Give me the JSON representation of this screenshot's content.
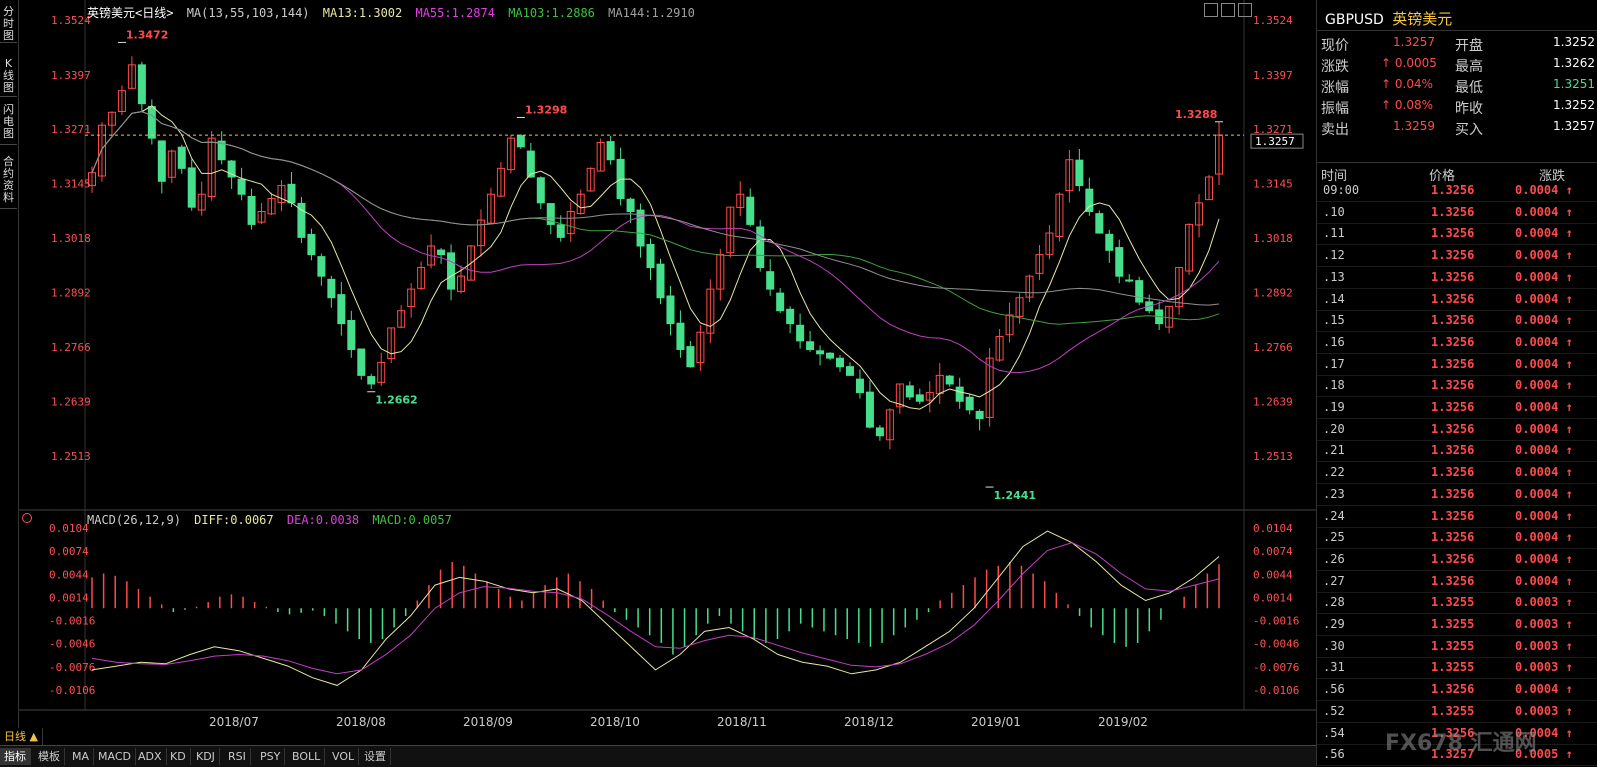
{
  "left_tabs": [
    "分时图",
    "K线图",
    "闪电图",
    "合约资料"
  ],
  "legend": {
    "symbol": "英镑美元",
    "period": "<日线>",
    "ma_params": "MA(13,55,103,144)",
    "ma13": "MA13:1.3002",
    "ma55": "MA55:1.2874",
    "ma103": "MA103:1.2886",
    "ma144": "MA144:1.2910"
  },
  "macd_legend": {
    "params": "MACD(26,12,9)",
    "diff": "DIFF:0.0067",
    "dea": "DEA:0.0038",
    "macd": "MACD:0.0057"
  },
  "colors": {
    "up": "#ff4a4a",
    "down": "#46e08c",
    "ma13": "#e8e8a0",
    "ma55": "#c040c0",
    "ma103": "#40a040",
    "ma144": "#909090",
    "price_axis": "#ff5050",
    "ma55_text": "#e040e0",
    "ma103_text": "#40c040",
    "ma144_text": "#a0a0a0"
  },
  "price_axis": [
    "1.3524",
    "1.3397",
    "1.3271",
    "1.3145",
    "1.3018",
    "1.2892",
    "1.2766",
    "1.2639",
    "1.2513"
  ],
  "macd_axis": [
    "0.0104",
    "0.0074",
    "0.0044",
    "0.0014",
    "-0.0016",
    "-0.0046",
    "-0.0076",
    "-0.0106"
  ],
  "annotations": {
    "high1": "1.3472",
    "high2": "1.3298",
    "high3": "1.3288",
    "low1": "1.2662",
    "low2": "1.2441",
    "current": "1.3257"
  },
  "date_axis": [
    "2018/07",
    "2018/08",
    "2018/09",
    "2018/10",
    "2018/11",
    "2018/12",
    "2019/01",
    "2019/02"
  ],
  "quote": {
    "code": "GBPUSD",
    "name": "英镑美元",
    "rows": [
      {
        "l1": "现价",
        "v1": "1.3257",
        "l2": "开盘",
        "v2": "1.3252"
      },
      {
        "l1": "涨跌",
        "v1": "0.0005",
        "l2": "最高",
        "v2": "1.3262"
      },
      {
        "l1": "涨幅",
        "v1": "0.04%",
        "l2": "最低",
        "v2": "1.3251"
      },
      {
        "l1": "振幅",
        "v1": "0.08%",
        "l2": "昨收",
        "v2": "1.3252"
      },
      {
        "l1": "卖出",
        "v1": "1.3259",
        "l2": "买入",
        "v2": "1.3257"
      }
    ],
    "ticks_header": {
      "time": "时间",
      "price": "价格",
      "change": "涨跌"
    },
    "ticks": [
      {
        "t": "09:00",
        "p": "1.3256",
        "c": "0.0004"
      },
      {
        "t": ".10",
        "p": "1.3256",
        "c": "0.0004"
      },
      {
        "t": ".11",
        "p": "1.3256",
        "c": "0.0004"
      },
      {
        "t": ".12",
        "p": "1.3256",
        "c": "0.0004"
      },
      {
        "t": ".13",
        "p": "1.3256",
        "c": "0.0004"
      },
      {
        "t": ".14",
        "p": "1.3256",
        "c": "0.0004"
      },
      {
        "t": ".15",
        "p": "1.3256",
        "c": "0.0004"
      },
      {
        "t": ".16",
        "p": "1.3256",
        "c": "0.0004"
      },
      {
        "t": ".17",
        "p": "1.3256",
        "c": "0.0004"
      },
      {
        "t": ".18",
        "p": "1.3256",
        "c": "0.0004"
      },
      {
        "t": ".19",
        "p": "1.3256",
        "c": "0.0004"
      },
      {
        "t": ".20",
        "p": "1.3256",
        "c": "0.0004"
      },
      {
        "t": ".21",
        "p": "1.3256",
        "c": "0.0004"
      },
      {
        "t": ".22",
        "p": "1.3256",
        "c": "0.0004"
      },
      {
        "t": ".23",
        "p": "1.3256",
        "c": "0.0004"
      },
      {
        "t": ".24",
        "p": "1.3256",
        "c": "0.0004"
      },
      {
        "t": ".25",
        "p": "1.3256",
        "c": "0.0004"
      },
      {
        "t": ".26",
        "p": "1.3256",
        "c": "0.0004"
      },
      {
        "t": ".27",
        "p": "1.3256",
        "c": "0.0004"
      },
      {
        "t": ".28",
        "p": "1.3255",
        "c": "0.0003"
      },
      {
        "t": ".29",
        "p": "1.3255",
        "c": "0.0003"
      },
      {
        "t": ".30",
        "p": "1.3255",
        "c": "0.0003"
      },
      {
        "t": ".31",
        "p": "1.3255",
        "c": "0.0003"
      },
      {
        "t": ".56",
        "p": "1.3256",
        "c": "0.0004"
      },
      {
        "t": ".52",
        "p": "1.3255",
        "c": "0.0003"
      },
      {
        "t": ".54",
        "p": "1.3256",
        "c": "0.0004"
      },
      {
        "t": ".56",
        "p": "1.3257",
        "c": "0.0005"
      }
    ]
  },
  "bottom_tabs": [
    "日线 ▲",
    "指标",
    "模板",
    "MA",
    "MACD",
    "ADX",
    "KD",
    "KDJ",
    "RSI",
    "PSY",
    "BOLL",
    "VOL",
    "设置"
  ],
  "watermark": "FX678 汇通网",
  "chart_data": [
    {
      "type": "candlestick",
      "title": "英镑美元<日线>",
      "ylim": [
        1.2441,
        1.3524
      ],
      "x_labels": [
        "2018/07",
        "2018/08",
        "2018/09",
        "2018/10",
        "2018/11",
        "2018/12",
        "2019/01",
        "2019/02"
      ],
      "close_series": [
        1.317,
        1.328,
        1.331,
        1.336,
        1.342,
        1.333,
        1.325,
        1.315,
        1.322,
        1.318,
        1.309,
        1.312,
        1.325,
        1.32,
        1.316,
        1.312,
        1.305,
        1.308,
        1.311,
        1.314,
        1.31,
        1.302,
        1.298,
        1.293,
        1.288,
        1.282,
        1.276,
        1.27,
        1.268,
        1.273,
        1.281,
        1.285,
        1.29,
        1.295,
        1.3,
        1.298,
        1.29,
        1.293,
        1.3,
        1.306,
        1.312,
        1.318,
        1.325,
        1.323,
        1.316,
        1.31,
        1.305,
        1.302,
        1.308,
        1.312,
        1.318,
        1.324,
        1.32,
        1.311,
        1.308,
        1.3,
        1.295,
        1.288,
        1.282,
        1.276,
        1.272,
        1.28,
        1.29,
        1.298,
        1.309,
        1.312,
        1.305,
        1.295,
        1.29,
        1.285,
        1.282,
        1.278,
        1.276,
        1.275,
        1.274,
        1.272,
        1.27,
        1.266,
        1.258,
        1.256,
        1.262,
        1.268,
        1.265,
        1.264,
        1.266,
        1.27,
        1.268,
        1.264,
        1.262,
        1.26,
        1.274,
        1.279,
        1.284,
        1.288,
        1.293,
        1.298,
        1.303,
        1.312,
        1.32,
        1.314,
        1.308,
        1.303,
        1.299,
        1.293,
        1.292,
        1.287,
        1.285,
        1.282,
        1.286,
        1.295,
        1.305,
        1.31,
        1.316,
        1.3257
      ],
      "highs": [
        {
          "label": "1.3472",
          "value": 1.3472
        },
        {
          "label": "1.3298",
          "value": 1.3298
        },
        {
          "label": "1.3288",
          "value": 1.3288
        }
      ],
      "lows": [
        {
          "label": "1.2662",
          "value": 1.2662
        },
        {
          "label": "1.2441",
          "value": 1.2441
        }
      ],
      "current": 1.3257
    },
    {
      "type": "bar",
      "title": "MACD(26,12,9)",
      "ylim": [
        -0.0106,
        0.0104
      ],
      "series": [
        {
          "name": "MACD",
          "values": [
            0.004,
            0.0045,
            0.0042,
            0.0035,
            0.0025,
            0.0015,
            0.0005,
            -0.0005,
            -0.0002,
            0.0002,
            0.0008,
            0.0015,
            0.0018,
            0.0015,
            0.0008,
            0.0002,
            -0.0005,
            -0.0008,
            -0.0006,
            -0.0003,
            -0.001,
            -0.002,
            -0.003,
            -0.004,
            -0.0045,
            -0.004,
            -0.0025,
            -0.001,
            0.001,
            0.003,
            0.005,
            0.006,
            0.0055,
            0.0045,
            0.0035,
            0.0025,
            0.0015,
            0.001,
            0.002,
            0.003,
            0.004,
            0.0045,
            0.0035,
            0.0025,
            0.001,
            -0.0005,
            -0.0015,
            -0.0025,
            -0.0035,
            -0.0045,
            -0.006,
            -0.005,
            -0.0035,
            -0.002,
            -0.001,
            -0.002,
            -0.003,
            -0.004,
            -0.0045,
            -0.004,
            -0.003,
            -0.002,
            -0.0025,
            -0.003,
            -0.0035,
            -0.004,
            -0.0045,
            -0.005,
            -0.0045,
            -0.0035,
            -0.0025,
            -0.0015,
            -0.0005,
            0.001,
            0.002,
            0.003,
            0.004,
            0.005,
            0.0055,
            0.006,
            0.0055,
            0.0045,
            0.0035,
            0.002,
            0.0005,
            -0.001,
            -0.0025,
            -0.0035,
            -0.0045,
            -0.005,
            -0.0045,
            -0.003,
            -0.0015,
            0.0,
            0.0015,
            0.003,
            0.0045,
            0.0057
          ]
        },
        {
          "name": "DIFF",
          "values": [
            -0.008,
            -0.0075,
            -0.007,
            -0.0072,
            -0.006,
            -0.005,
            -0.0055,
            -0.0065,
            -0.0075,
            -0.009,
            -0.01,
            -0.008,
            -0.004,
            -0.001,
            0.003,
            0.004,
            0.0035,
            0.0025,
            0.002,
            0.0025,
            0.001,
            -0.002,
            -0.005,
            -0.008,
            -0.006,
            -0.003,
            -0.0025,
            -0.004,
            -0.006,
            -0.007,
            -0.0075,
            -0.0085,
            -0.008,
            -0.007,
            -0.005,
            -0.003,
            0.0,
            0.004,
            0.008,
            0.01,
            0.0085,
            0.006,
            0.003,
            0.001,
            0.002,
            0.004,
            0.0067
          ]
        },
        {
          "name": "DEA",
          "values": [
            -0.0065,
            -0.007,
            -0.0072,
            -0.0073,
            -0.0068,
            -0.0062,
            -0.006,
            -0.0062,
            -0.0068,
            -0.0078,
            -0.0085,
            -0.008,
            -0.006,
            -0.0035,
            0.0,
            0.002,
            0.0028,
            0.0026,
            0.0022,
            0.002,
            0.0012,
            -0.0008,
            -0.003,
            -0.005,
            -0.0052,
            -0.0042,
            -0.0035,
            -0.0038,
            -0.0048,
            -0.0058,
            -0.0066,
            -0.0074,
            -0.0076,
            -0.0072,
            -0.006,
            -0.0045,
            -0.0022,
            0.001,
            0.0045,
            0.0075,
            0.0085,
            0.007,
            0.0045,
            0.0025,
            0.0022,
            0.003,
            0.0038
          ]
        }
      ]
    }
  ]
}
